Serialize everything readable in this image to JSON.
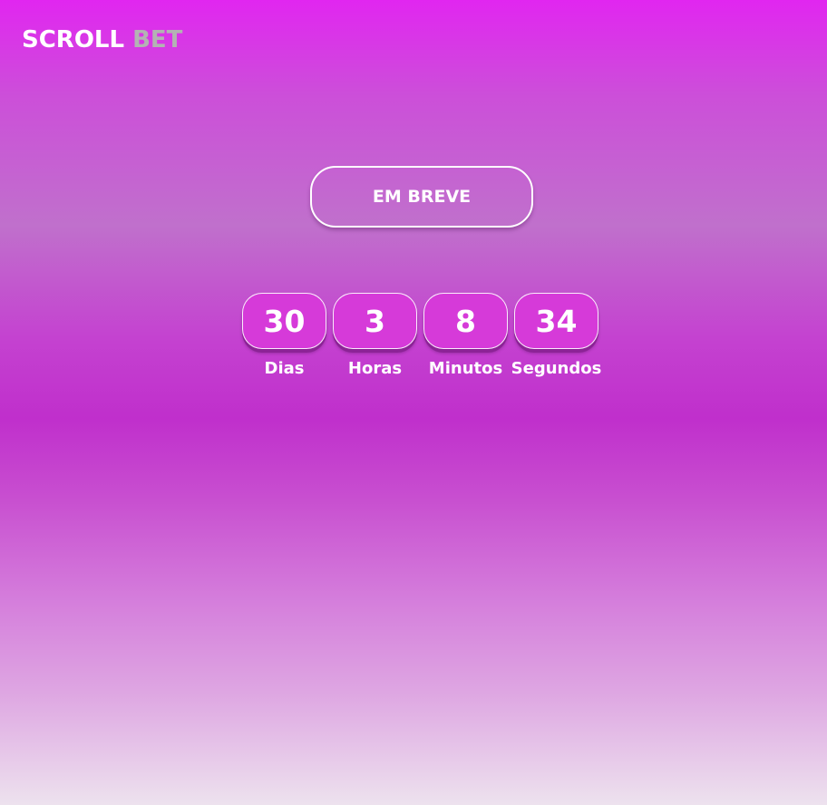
{
  "logo": {
    "part1": "SCROLL",
    "part2": "BET"
  },
  "banner": {
    "label": "EM BREVE"
  },
  "countdown": [
    {
      "value": "30",
      "label": "Dias"
    },
    {
      "value": "3",
      "label": "Horas"
    },
    {
      "value": "8",
      "label": "Minutos"
    },
    {
      "value": "34",
      "label": "Segundos"
    }
  ],
  "colors": {
    "gradient_top": "#e126f0",
    "gradient_bottom": "#ede2ee",
    "box_fill": "#d63ad9",
    "logo_primary": "#ffffff",
    "logo_secondary": "#b3b3b3"
  }
}
